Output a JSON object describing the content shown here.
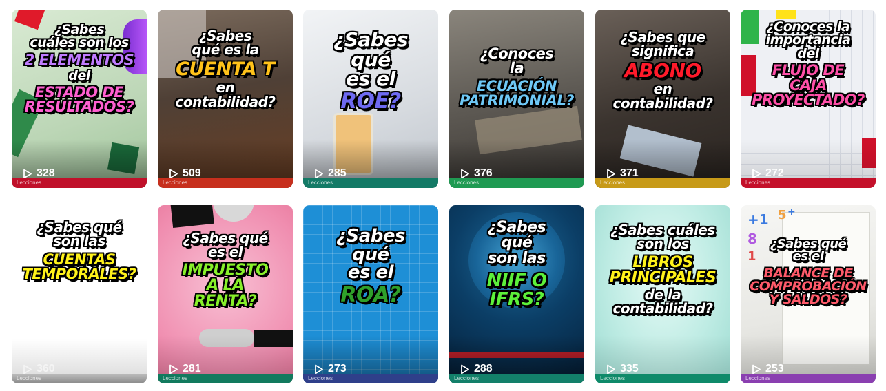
{
  "strip_label": "Lecciones",
  "cards": [
    {
      "lines": [
        "¿Sabes",
        "cuáles son los"
      ],
      "highlight": [
        "2 ELEMENTOS"
      ],
      "after": [
        "del"
      ],
      "highlight2": [
        "ESTADO DE",
        "RESULTADOS?"
      ],
      "views": "328",
      "bg": "#c9dfc5",
      "strip": "#c0102a",
      "hl_color": "#c07cff",
      "hl2_color": "#ff5fd0"
    },
    {
      "lines": [
        "¿Sabes",
        "qué es la"
      ],
      "highlight": [
        "CUENTA T"
      ],
      "after": [
        "en",
        "contabilidad?"
      ],
      "views": "509",
      "bg": "#5a4a3e",
      "strip": "#c72f1d",
      "hl_color": "#ffc21a"
    },
    {
      "lines": [
        "¿Sabes",
        "qué",
        "es el"
      ],
      "highlight": [
        "ROE?"
      ],
      "after": [],
      "views": "285",
      "bg": "#dfe3e6",
      "strip": "#137a66",
      "hl_color": "#6e6af2"
    },
    {
      "lines": [
        "¿Conoces",
        "la"
      ],
      "highlight": [
        "ECUACIÓN",
        "PATRIMONIAL?"
      ],
      "after": [],
      "views": "376",
      "bg": "#6e6a62",
      "strip": "#1f9a52",
      "hl_color": "#6ec8f6"
    },
    {
      "lines": [
        "¿Sabes que",
        "significa"
      ],
      "highlight": [
        "ABONO"
      ],
      "after": [
        "en",
        "contabilidad?"
      ],
      "views": "371",
      "bg": "#3a3430",
      "strip": "#c79a18",
      "hl_color": "#ff1a2a"
    },
    {
      "lines": [
        "¿Conoces la",
        "importancia",
        "del"
      ],
      "highlight": [
        "FLUJO DE",
        "CAJA",
        "PROYECTADO?"
      ],
      "after": [],
      "views": "272",
      "bg": "#eef0f4",
      "strip": "#c4102a",
      "hl_color": "#ff4fa8"
    },
    {
      "lines": [
        "¿Sabes qué",
        "son las"
      ],
      "highlight": [
        "CUENTAS",
        "TEMPORALES?"
      ],
      "after": [],
      "views": "360",
      "bg": "#ffffff",
      "strip": "#2a2a2a",
      "hl_color": "#fff21a"
    },
    {
      "lines": [
        "¿Sabes qué",
        "es el"
      ],
      "highlight": [
        "IMPUESTO",
        "A LA",
        "RENTA?"
      ],
      "after": [],
      "views": "281",
      "bg": "#f3a6c2",
      "strip": "#127a5e",
      "hl_color": "#88f02a"
    },
    {
      "lines": [
        "¿Sabes",
        "qué",
        "es el"
      ],
      "highlight": [
        "ROA?"
      ],
      "after": [],
      "views": "273",
      "bg": "#1e8fd6",
      "strip": "#2f3f8a",
      "hl_color": "#2fa02a"
    },
    {
      "lines": [
        "¿Sabes",
        "qué",
        "son las"
      ],
      "highlight": [
        "NIIF O",
        "IFRS?"
      ],
      "after": [],
      "views": "288",
      "bg": "#08304f",
      "strip": "#13806a",
      "hl_color": "#5cf03a"
    },
    {
      "lines": [
        "¿Sabes cuáles",
        "son los"
      ],
      "highlight": [
        "LIBROS",
        "PRINCIPALES"
      ],
      "after": [
        "de la",
        "contabilidad?"
      ],
      "views": "335",
      "bg": "#c7efe9",
      "strip": "#0f8a6a",
      "hl_color": "#fff21a"
    },
    {
      "lines": [
        "¿Sabes qué",
        "es el"
      ],
      "highlight": [
        "BALANCE DE",
        "COMPROBACIÓN",
        "Y SALDOS?"
      ],
      "after": [],
      "views": "253",
      "bg": "#f1f1ef",
      "strip": "#8a3fb0",
      "hl_color": "#ff5a6a"
    }
  ]
}
